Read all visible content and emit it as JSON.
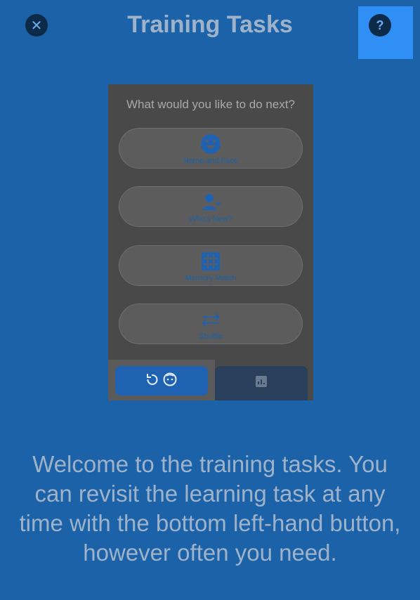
{
  "header": {
    "close_icon": "close-icon",
    "close_glyph": "✕",
    "title": "Training Tasks",
    "help_icon": "help-icon",
    "help_glyph": "?"
  },
  "preview": {
    "prompt": "What would you like to do next?",
    "options": [
      {
        "label": "Name and Face",
        "icon": "face-icon"
      },
      {
        "label": "Who's New?",
        "icon": "add-person-icon"
      },
      {
        "label": "Memory Match",
        "icon": "grid-icon"
      },
      {
        "label": "Shuffle",
        "icon": "swap-arrows-icon"
      }
    ],
    "tabs": [
      {
        "icon": "revisit-learning-icon",
        "selected": true
      },
      {
        "icon": "stats-icon",
        "selected": false
      }
    ]
  },
  "welcome_text": "Welcome to the training tasks. You can revisit the learning task at any time with the bottom left-hand button, however often you need.",
  "colors": {
    "background": "#1c62a8",
    "highlight": "#2f8ff5",
    "title_text": "#9eb3c9",
    "overlay": "#494949"
  }
}
